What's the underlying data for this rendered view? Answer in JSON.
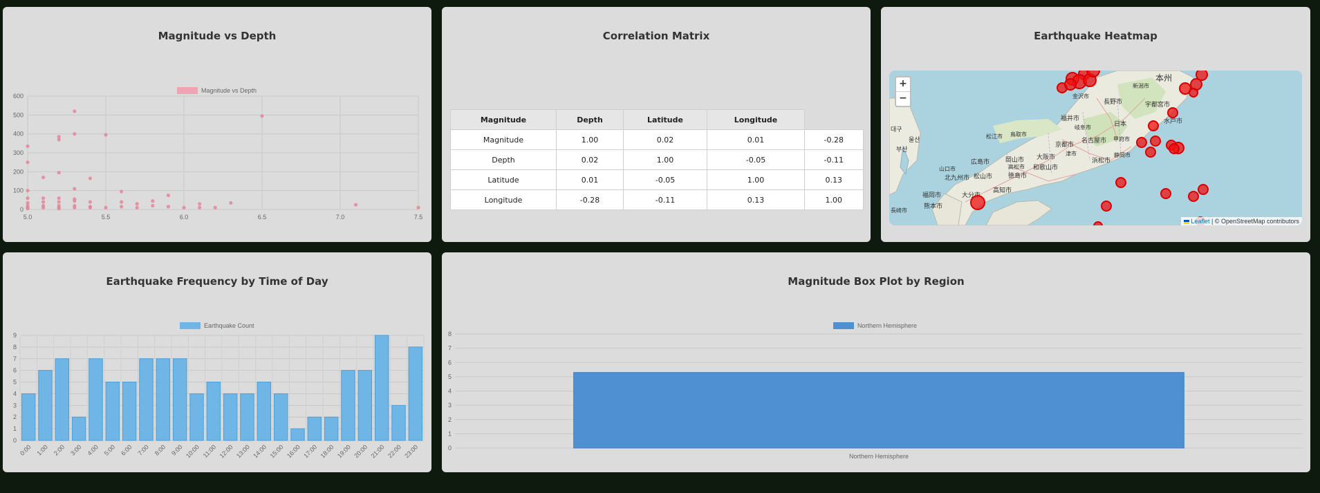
{
  "scatter_card": {
    "title": "Magnitude vs Depth",
    "legend": "Magnitude vs Depth",
    "y_ticks": [
      "600",
      "500",
      "400",
      "300",
      "200",
      "100",
      "0"
    ],
    "x_ticks": [
      "5.0",
      "5.5",
      "6.0",
      "6.5",
      "7.0",
      "7.5"
    ]
  },
  "correlation_card": {
    "title": "Correlation Matrix",
    "headers": [
      "Magnitude",
      "Depth",
      "Latitude",
      "Longitude"
    ],
    "rows": [
      {
        "label": "Magnitude",
        "values": [
          "1.00",
          "0.02",
          "0.01",
          "-0.28"
        ]
      },
      {
        "label": "Depth",
        "values": [
          "0.02",
          "1.00",
          "-0.05",
          "-0.11"
        ]
      },
      {
        "label": "Latitude",
        "values": [
          "0.01",
          "-0.05",
          "1.00",
          "0.13"
        ]
      },
      {
        "label": "Longitude",
        "values": [
          "-0.28",
          "-0.11",
          "0.13",
          "1.00"
        ]
      }
    ]
  },
  "map_card": {
    "title": "Earthquake Heatmap",
    "zoom_in": "+",
    "zoom_out": "−",
    "attribution_link": "Leaflet",
    "attribution_sep": " | © ",
    "attribution_text": "OpenStreetMap contributors",
    "labels": {
      "honshu": "本州",
      "osaka": "大阪市",
      "kyoto": "京都市",
      "nagoya": "名古屋市",
      "hiroshima": "広島市",
      "kitakyushu": "北九州市",
      "fukuoka": "福岡市",
      "kumamoto": "熊本市",
      "oita": "大分市",
      "matsuyama": "松山市",
      "tokushima": "徳島市",
      "kochi": "高知市",
      "wakayama": "和歌山市",
      "okayama": "岡山市",
      "fukui": "福井市",
      "kanazawa": "金沢市",
      "nagano": "長野市",
      "niigata": "新潟市",
      "utsunomiya": "宇都宮市",
      "mito": "水戸市",
      "hamamatsu": "浜松市",
      "kofu": "甲府市",
      "shizuoka": "静岡市",
      "daegu": "대구",
      "ulsan": "울산",
      "busan": "부산",
      "japan": "日本",
      "tsu": "津市",
      "gifu": "岐阜市",
      "tottori": "鳥取市",
      "yamaguchi": "山口市",
      "matsue": "松江市",
      "nagasaki": "長崎市",
      "takamatsu": "高松市"
    }
  },
  "frequency_card": {
    "title": "Earthquake Frequency by Time of Day",
    "legend": "Earthquake Count",
    "y_ticks": [
      "9",
      "8",
      "7",
      "6",
      "5",
      "4",
      "3",
      "2",
      "1",
      "0"
    ]
  },
  "box_card": {
    "title": "Magnitude Box Plot by Region",
    "legend": "Northern Hemisphere",
    "y_ticks": [
      "8",
      "7",
      "6",
      "5",
      "4",
      "3",
      "2",
      "1",
      "0"
    ]
  },
  "colors": {
    "scatter": "#e3869a",
    "frequency": "#6fb6e6",
    "box": "#4f90d2",
    "map_marker": "#ee1111"
  },
  "chart_data": [
    {
      "type": "scatter",
      "title": "Magnitude vs Depth",
      "series": [
        {
          "name": "Magnitude vs Depth",
          "points": [
            [
              5.0,
              10
            ],
            [
              5.0,
              20
            ],
            [
              5.0,
              35
            ],
            [
              5.0,
              60
            ],
            [
              5.0,
              100
            ],
            [
              5.0,
              250
            ],
            [
              5.0,
              335
            ],
            [
              5.0,
              5
            ],
            [
              5.1,
              20
            ],
            [
              5.1,
              40
            ],
            [
              5.1,
              60
            ],
            [
              5.1,
              170
            ],
            [
              5.1,
              10
            ],
            [
              5.2,
              10
            ],
            [
              5.2,
              20
            ],
            [
              5.2,
              40
            ],
            [
              5.2,
              60
            ],
            [
              5.2,
              195
            ],
            [
              5.2,
              370
            ],
            [
              5.2,
              385
            ],
            [
              5.2,
              5
            ],
            [
              5.3,
              10
            ],
            [
              5.3,
              20
            ],
            [
              5.3,
              45
            ],
            [
              5.3,
              55
            ],
            [
              5.3,
              110
            ],
            [
              5.3,
              400
            ],
            [
              5.3,
              520
            ],
            [
              5.4,
              15
            ],
            [
              5.4,
              40
            ],
            [
              5.4,
              165
            ],
            [
              5.4,
              10
            ],
            [
              5.5,
              10
            ],
            [
              5.5,
              395
            ],
            [
              5.6,
              15
            ],
            [
              5.6,
              40
            ],
            [
              5.6,
              95
            ],
            [
              5.7,
              10
            ],
            [
              5.7,
              30
            ],
            [
              5.8,
              20
            ],
            [
              5.8,
              45
            ],
            [
              5.9,
              15
            ],
            [
              5.9,
              75
            ],
            [
              6.0,
              10
            ],
            [
              6.1,
              10
            ],
            [
              6.1,
              30
            ],
            [
              6.2,
              10
            ],
            [
              6.3,
              35
            ],
            [
              6.5,
              495
            ],
            [
              7.1,
              25
            ],
            [
              7.5,
              10
            ]
          ]
        }
      ],
      "xlim": [
        5.0,
        7.5
      ],
      "ylim": [
        0,
        600
      ],
      "grid": true,
      "legend": "top"
    },
    {
      "type": "bar",
      "title": "Earthquake Frequency by Time of Day",
      "categories": [
        "0:00",
        "1:00",
        "2:00",
        "3:00",
        "4:00",
        "5:00",
        "6:00",
        "7:00",
        "8:00",
        "9:00",
        "10:00",
        "11:00",
        "12:00",
        "13:00",
        "14:00",
        "15:00",
        "16:00",
        "17:00",
        "18:00",
        "19:00",
        "20:00",
        "21:00",
        "22:00",
        "23:00"
      ],
      "series": [
        {
          "name": "Earthquake Count",
          "values": [
            4,
            6,
            7,
            2,
            7,
            5,
            5,
            7,
            7,
            7,
            4,
            5,
            4,
            4,
            5,
            4,
            1,
            2,
            2,
            6,
            6,
            9,
            3,
            8
          ]
        }
      ],
      "ylim": [
        0,
        9
      ],
      "grid": true,
      "legend": "top"
    },
    {
      "type": "bar",
      "title": "Magnitude Box Plot by Region",
      "categories": [
        "Northern Hemisphere"
      ],
      "series": [
        {
          "name": "Northern Hemisphere",
          "values": [
            5.3
          ]
        }
      ],
      "ylim": [
        0,
        8
      ],
      "grid": true,
      "legend": "top"
    }
  ]
}
